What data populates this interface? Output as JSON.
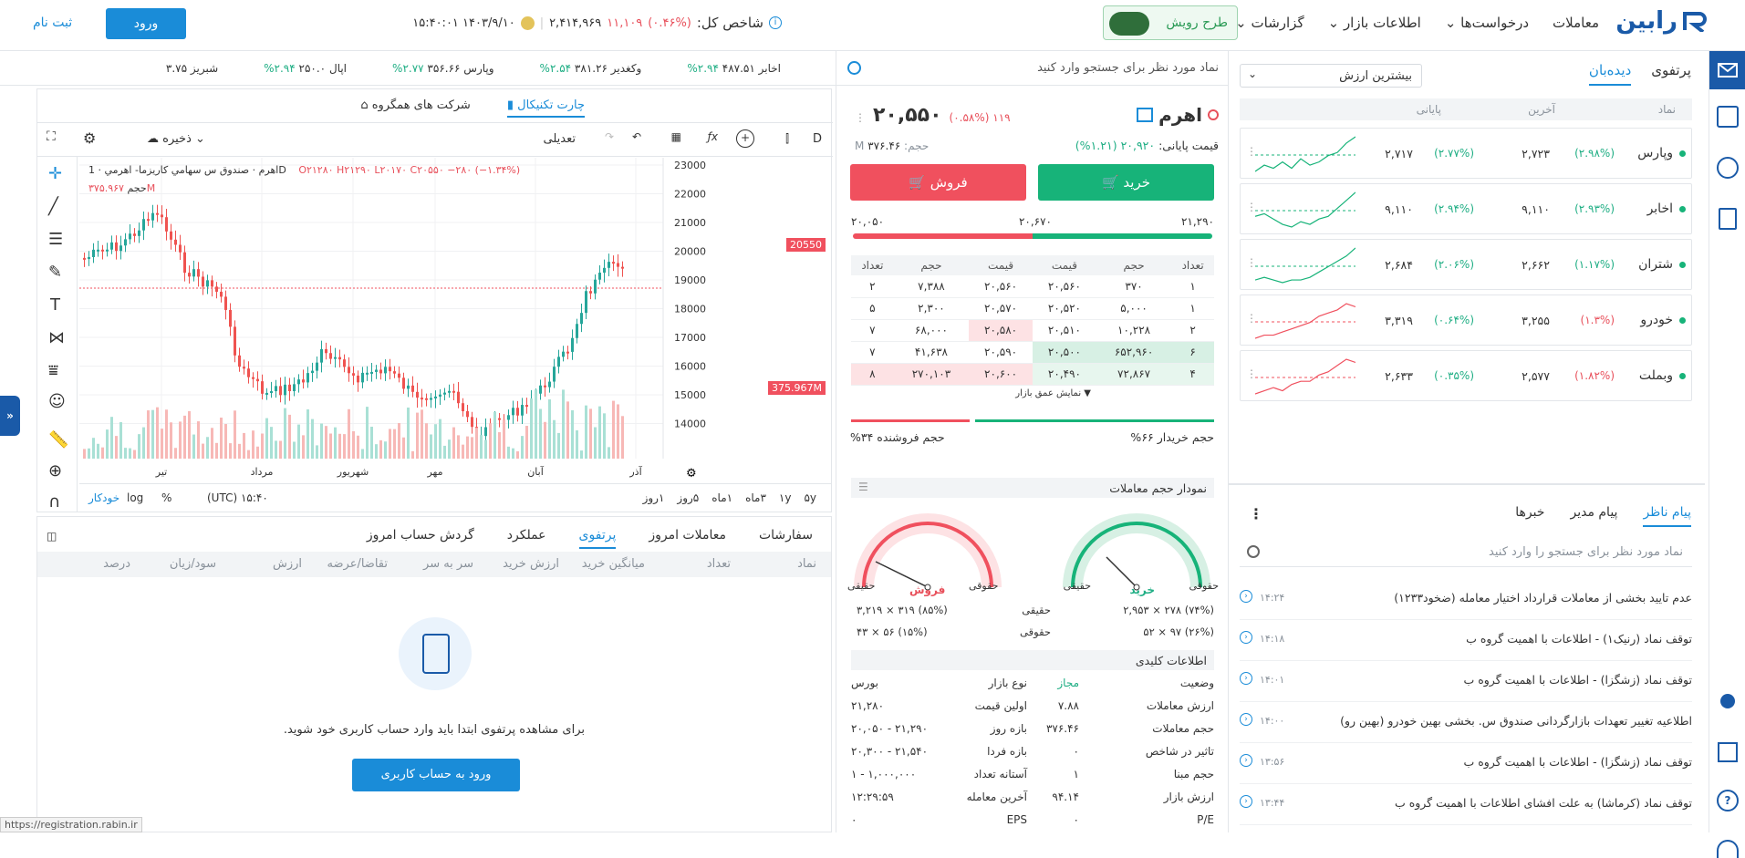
{
  "header": {
    "brand": "رابین",
    "nav": [
      "معاملات",
      "درخواست‌ها",
      "اطلاعات بازار",
      "گزارشات"
    ],
    "campaign": "طرح رویش",
    "index_label": "شاخص کل:",
    "index_pct": "(۰.۴۶%)",
    "index_change": "۱۱,۱۰۹",
    "index_value": "۲,۴۱۴,۹۶۹",
    "datetime": "۱۴۰۳/۹/۱۰  ۱۵:۴۰:۰۱",
    "login": "ورود",
    "register": "ثبت نام"
  },
  "watch": {
    "tabs": [
      "دیده‌بان",
      "پرتفوی"
    ],
    "sort": "بیشترین ارزش",
    "cols": [
      "نماد",
      "آخرین",
      "پایانی"
    ],
    "items": [
      {
        "sym": "وپارس",
        "last": "۲,۷۲۳",
        "lpct": "(۲.۹۸%)",
        "close": "۲,۷۱۷",
        "cpct": "(۲.۷۷%)",
        "up": true,
        "spark": [
          3,
          5,
          4,
          6,
          4,
          7,
          5,
          6,
          8,
          9,
          12,
          14
        ]
      },
      {
        "sym": "اخابر",
        "last": "۹,۱۱۰",
        "lpct": "(۲.۹۳%)",
        "close": "۹,۱۱۰",
        "cpct": "(۲.۹۴%)",
        "up": true,
        "spark": [
          6,
          7,
          5,
          3,
          2,
          4,
          3,
          5,
          6,
          9,
          12,
          15
        ]
      },
      {
        "sym": "شتران",
        "last": "۲,۶۶۲",
        "lpct": "(۱.۱۷%)",
        "close": "۲,۶۸۴",
        "cpct": "(۲.۰۶%)",
        "up": true,
        "spark": [
          3,
          4,
          3,
          2,
          3,
          3,
          4,
          6,
          8,
          10,
          12,
          15
        ]
      },
      {
        "sym": "خودرو",
        "last": "۳,۲۵۵",
        "lpct": "(۱.۳%)",
        "close": "۳,۳۱۹",
        "cpct": "(۰.۶۴%)",
        "up": false,
        "spark": [
          2,
          3,
          3,
          4,
          5,
          6,
          7,
          9,
          10,
          11,
          13,
          12
        ]
      },
      {
        "sym": "وبملت",
        "last": "۲,۵۷۷",
        "lpct": "(۱.۸۲%)",
        "close": "۲,۶۳۳",
        "cpct": "(۰.۳۵%)",
        "up": false,
        "spark": [
          2,
          3,
          4,
          3,
          5,
          6,
          6,
          8,
          9,
          11,
          13,
          12
        ]
      }
    ]
  },
  "news": {
    "tabs": [
      "پیام ناظر",
      "پیام مدیر",
      "خبرها"
    ],
    "search_placeholder": "نماد مورد نظر برای جستجو را وارد کنید",
    "items": [
      {
        "title": "عدم تایید بخشی از معاملات قرارداد اختیار معامله (ضخود۱۲۳۳)",
        "time": "۱۴:۲۴"
      },
      {
        "title": "توقف نماد (رنیک۱) - اطلاعات با اهمیت گروه ب",
        "time": "۱۴:۱۸"
      },
      {
        "title": "توقف نماد (زشگزا) - اطلاعات با اهمیت گروه ب",
        "time": "۱۴:۰۱"
      },
      {
        "title": "اطلاعیه تغییر تعهدات بازارگردانی صندوق س. بخشی بهین خودرو (بهین رو)",
        "time": "۱۴:۰۰"
      },
      {
        "title": "توقف نماد (زشگزا) - اطلاعات با اهمیت گروه ب",
        "time": "۱۳:۵۶"
      },
      {
        "title": "توقف نماد (کرماشا) به علت افشای اطلاعات با اهمیت گروه ب",
        "time": "۱۳:۴۴"
      }
    ]
  },
  "symbol": {
    "search_placeholder": "نماد مورد نظر برای جستجو وارد کنید",
    "name": "اهرم",
    "price": "۲۰,۵۵۰",
    "change": "۱۱۹",
    "pct": "(۰.۵۸%)",
    "close_label": "قیمت پایانی:",
    "close": "۲۰,۹۲۰",
    "close_pct": "(۱.۲۱%)",
    "volume_label": "حجم:",
    "volume": "۳۷۶.۴۶",
    "buy": "خرید",
    "sell": "فروش",
    "range_low": "۲۰,۰۵۰",
    "range_mid": "۲۰,۶۷۰",
    "range_high": "۲۱,۲۹۰"
  },
  "orderbook": {
    "headers": [
      "تعداد",
      "حجم",
      "قیمت",
      "قیمت",
      "حجم",
      "تعداد"
    ],
    "rows": [
      [
        "۱",
        "۳۷۰",
        "۲۰,۵۶۰",
        "۲۰,۵۶۰",
        "۷,۳۸۸",
        "۲"
      ],
      [
        "۱",
        "۵,۰۰۰",
        "۲۰,۵۲۰",
        "۲۰,۵۷۰",
        "۲,۳۰۰",
        "۵"
      ],
      [
        "۲",
        "۱۰,۲۲۸",
        "۲۰,۵۱۰",
        "۲۰,۵۸۰",
        "۶۸,۰۰۰",
        "۷"
      ],
      [
        "۶",
        "۶۵۲,۹۶۰",
        "۲۰,۵۰۰",
        "۲۰,۵۹۰",
        "۴۱,۶۳۸",
        "۷"
      ],
      [
        "۴",
        "۷۲,۸۶۷",
        "۲۰,۴۹۰",
        "۲۰,۶۰۰",
        "۲۷۰,۱۰۳",
        "۸"
      ]
    ],
    "depth": "نمایش عمق بازار",
    "buyer_vol": "حجم خریدار ۶۶%",
    "seller_vol": "حجم فروشنده ۳۴%"
  },
  "gauges": {
    "title": "نمودار حجم معاملات",
    "buy": "خرید",
    "sell": "فروش",
    "legal": "حقوقی",
    "real": "حقیقی",
    "buy_real": "(۷۴%)  ۲۷۸  ×  ۲,۹۵۳",
    "buy_legal": "(۲۶%)  ۹۷  ×  ۵۲",
    "sell_real": "(۸۵%)  ۳۱۹  ×  ۳,۲۱۹",
    "sell_legal": "(۱۵%)  ۵۶  ×  ۴۳",
    "buy_fill": 0.74,
    "sell_fill": 0.85
  },
  "keyinfo": {
    "title": "اطلاعات کلیدی",
    "left": [
      [
        "وضعیت",
        "مجاز"
      ],
      [
        "ارزش معاملات",
        "۷.۸۸"
      ],
      [
        "حجم معاملات",
        "۳۷۶.۴۶"
      ],
      [
        "تاثیر در شاخص",
        "۰"
      ],
      [
        "حجم مبنا",
        "۱"
      ],
      [
        "ارزش بازار",
        "۹۴.۱۴"
      ],
      [
        "P/E",
        "۰"
      ]
    ],
    "right": [
      [
        "نوع بازار",
        "بورس"
      ],
      [
        "اولین قیمت",
        "۲۱,۲۸۰"
      ],
      [
        "بازه روز",
        "۲۰,۰۵۰ - ۲۱,۲۹۰"
      ],
      [
        "بازه فردا",
        "۲۰,۳۰۰ - ۲۱,۵۴۰"
      ],
      [
        "آستانه تعداد",
        "۱ - ۱,۰۰۰,۰۰۰"
      ],
      [
        "آخرین معامله",
        "۱۲:۲۹:۵۹"
      ],
      [
        "EPS",
        "۰"
      ]
    ]
  },
  "ticker": [
    {
      "sym": "اخابر",
      "val": "۴۸۷.۵۱",
      "pct": "۲.۹۴%"
    },
    {
      "sym": "وکغدیر",
      "val": "۳۸۱.۲۶",
      "pct": "۲.۵۴%"
    },
    {
      "sym": "وپارس",
      "val": "۳۵۶.۶۶",
      "pct": "۲.۷۷%"
    },
    {
      "sym": "اپال",
      "val": "۲۵۰.۰",
      "pct": "۲.۹۴%"
    },
    {
      "sym": "شبریز",
      "val": "۳.۷۵",
      "pct": ""
    }
  ],
  "chart": {
    "tabs": [
      "چارت تکنیکال",
      "شرکت های همگروه"
    ],
    "interval": "D",
    "adjust": "تعدیلی",
    "save": "ذخیره",
    "legend_name": "اهرم · صندوق س سهامي كاريزما- اهرمي · 1D",
    "ohlc": "O۲۱۲۸۰ H۲۱۲۹۰ L۲۰۱۷۰ C۲۰۵۵۰ −۲۸۰ (−۱.۳۴%)",
    "vol_label": "حجم",
    "vol_value": "۳۷۵.۹۶۷M",
    "price_badge": "20550",
    "vol_badge": "375.967M",
    "yticks": [
      "23000",
      "22000",
      "21000",
      "20000",
      "19000",
      "18000",
      "17000",
      "16000",
      "15000",
      "14000"
    ],
    "months": [
      "تیر",
      "مرداد",
      "شهریور",
      "مهر",
      "آبان",
      "آذر"
    ],
    "ranges": [
      "۵y",
      "۱y",
      "۳ماه",
      "۱ماه",
      "۵روز",
      "۱روز"
    ],
    "time": "(UTC) ۱۵:۴۰",
    "opts": [
      "%",
      "log",
      "خودکار"
    ]
  },
  "portfolio": {
    "tabs": [
      "سفارشات",
      "معاملات امروز",
      "پرتفوی",
      "عملکرد",
      "گردش حساب امروز"
    ],
    "cols": [
      "نماد",
      "تعداد",
      "میانگین خرید",
      "ارزش خرید",
      "سر به سر",
      "تقاضا/عرضه",
      "ارزش",
      "سود/زیان",
      "درصد"
    ],
    "empty": "برای مشاهده پرتفوی ابتدا باید وارد حساب کاربری خود شوید.",
    "login": "ورود به حساب کاربری"
  },
  "status_url": "https://registration.rabin.ir"
}
